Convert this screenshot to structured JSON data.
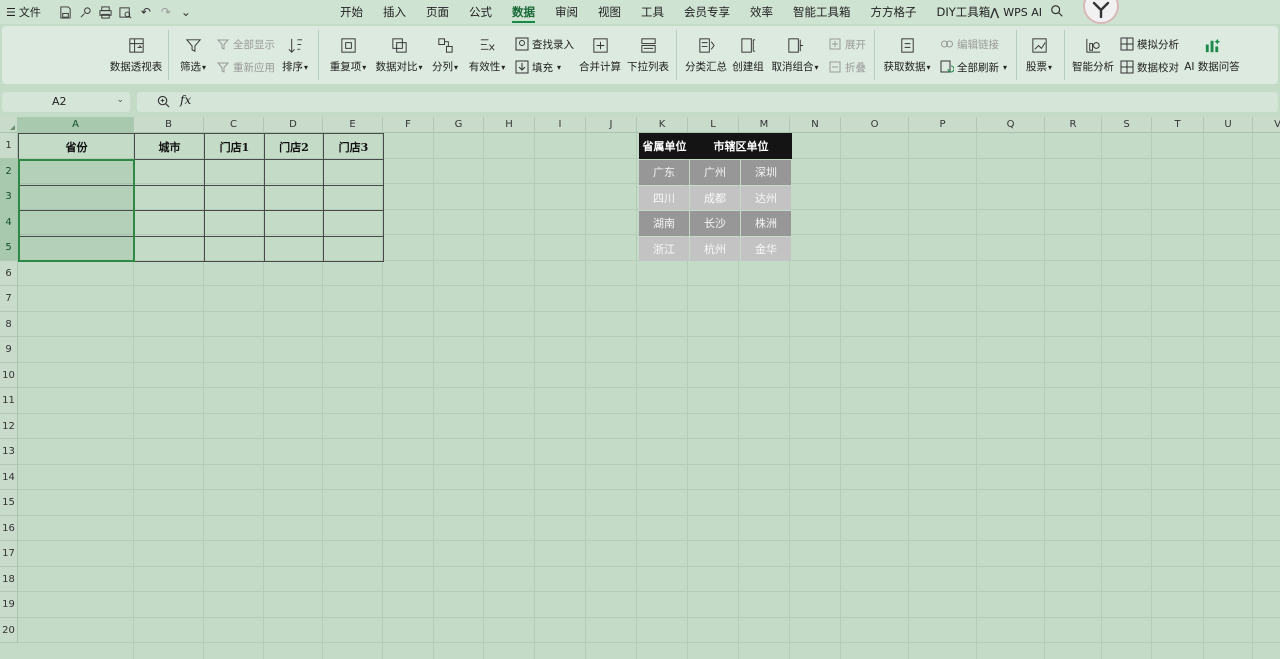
{
  "menubar": {
    "file_label": "文件",
    "tabs": [
      "开始",
      "插入",
      "页面",
      "公式",
      "数据",
      "审阅",
      "视图",
      "工具",
      "会员专享",
      "效率",
      "智能工具箱",
      "方方格子",
      "DIY工具箱"
    ],
    "active_tab": "数据",
    "wps_ai": "WPS AI"
  },
  "ribbon": {
    "pivot": "数据透视表",
    "filter": "筛选",
    "show_all": "全部显示",
    "reapply": "重新应用",
    "sort": "排序",
    "duplicates": "重复项",
    "compare": "数据对比",
    "split": "分列",
    "validity": "有效性",
    "lookup_entry": "查找录入",
    "fill": "填充",
    "consolidate": "合并计算",
    "dropdown": "下拉列表",
    "subtotal": "分类汇总",
    "create_group": "创建组",
    "ungroup": "取消组合",
    "expand": "展开",
    "collapse": "折叠",
    "get_data": "获取数据",
    "edit_links": "编辑链接",
    "refresh_all": "全部刷新",
    "stocks": "股票",
    "smart_analysis": "智能分析",
    "what_if": "模拟分析",
    "data_check": "数据校对",
    "ai_qa": "AI 数据问答"
  },
  "formula_bar": {
    "name_box": "A2",
    "fx_symbol": "fx",
    "content": ""
  },
  "grid": {
    "columns": [
      "A",
      "B",
      "C",
      "D",
      "E",
      "F",
      "G",
      "H",
      "I",
      "J",
      "K",
      "L",
      "M",
      "N",
      "O",
      "P",
      "Q",
      "R",
      "S",
      "T",
      "U",
      "V"
    ],
    "rows": [
      "1",
      "2",
      "3",
      "4",
      "5",
      "6",
      "7",
      "8",
      "9",
      "10",
      "11",
      "12",
      "13",
      "14",
      "15",
      "16",
      "17",
      "18",
      "19",
      "20"
    ],
    "selected_column": "A",
    "selected_rows": [
      "2",
      "3",
      "4",
      "5"
    ]
  },
  "table": {
    "headers": [
      "省份",
      "城市",
      "门店1",
      "门店2",
      "门店3"
    ]
  },
  "reference": {
    "header_left": "省属单位",
    "header_right": "市辖区单位",
    "rows": [
      [
        "广东",
        "广州",
        "深圳"
      ],
      [
        "四川",
        "成都",
        "达州"
      ],
      [
        "湖南",
        "长沙",
        "株洲"
      ],
      [
        "浙江",
        "杭州",
        "金华"
      ]
    ]
  }
}
